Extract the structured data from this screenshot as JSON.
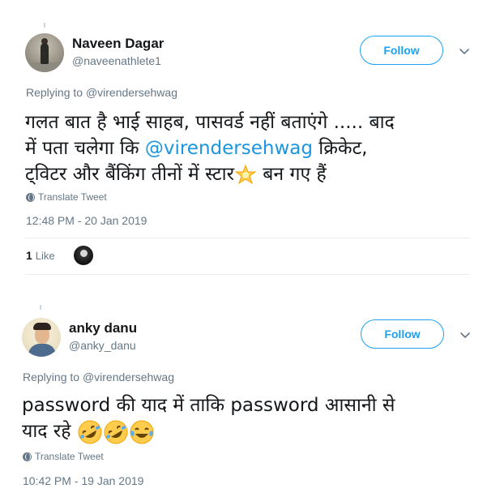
{
  "tweets": [
    {
      "author_name": "Naveen Dagar",
      "author_handle": "@naveenathlete1",
      "follow_label": "Follow",
      "replying_prefix": "Replying to ",
      "replying_mention": "@virendersehwag",
      "text_line1": "गलत बात है भाई साहब, पासवर्ड नहीं बताएंगे ..... बाद",
      "text_line2_prefix": "में पता चलेगा कि ",
      "text_line2_mention": "@virendersehwag",
      "text_line2_suffix": " क्रिकेट,",
      "text_line3_prefix": "ट्विटर और बैंकिंग तीनों में स्टार",
      "text_line3_suffix": " बन गए हैं",
      "emoji_icon": "glowing-star-icon",
      "translate_label": "Translate Tweet",
      "timestamp": "12:48 PM - 20 Jan 2019",
      "like_count": "1",
      "like_label": "Like"
    },
    {
      "author_name": "anky danu",
      "author_handle": "@anky_danu",
      "follow_label": "Follow",
      "replying_prefix": "Replying to ",
      "replying_mention": "@virendersehwag",
      "text_line1": "password की याद में ताकि password आसानी से",
      "text_line2": "याद रहे ",
      "emoji_icons": [
        "rolling-on-floor-laughing-icon",
        "rolling-on-floor-laughing-icon",
        "tears-of-joy-icon"
      ],
      "translate_label": "Translate Tweet",
      "timestamp": "10:42 PM - 19 Jan 2019"
    }
  ],
  "colors": {
    "accent": "#1da1f2",
    "mention": "#1b95e0",
    "secondary_text": "#657786",
    "divider": "#e6ecf0"
  }
}
